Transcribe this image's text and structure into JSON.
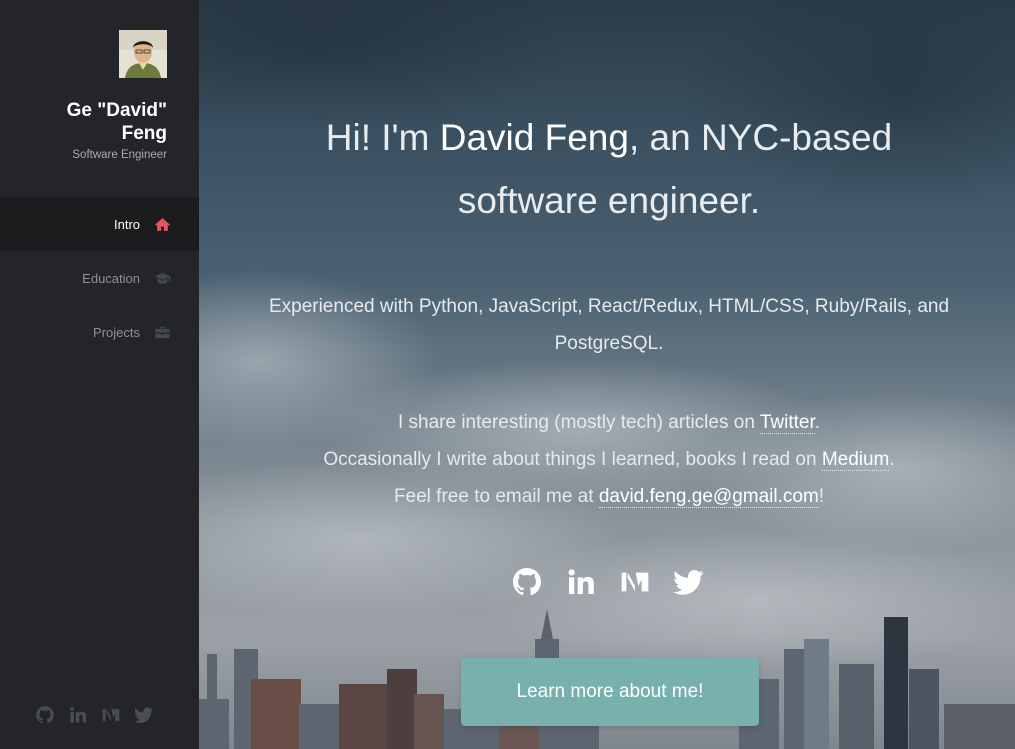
{
  "sidebar": {
    "name": "Ge \"David\" Feng",
    "role": "Software Engineer",
    "nav": [
      {
        "label": "Intro",
        "icon": "home-icon"
      },
      {
        "label": "Education",
        "icon": "graduation-cap-icon"
      },
      {
        "label": "Projects",
        "icon": "briefcase-icon"
      }
    ],
    "social_icons": [
      "github-icon",
      "linkedin-icon",
      "medium-icon",
      "twitter-icon"
    ]
  },
  "hero": {
    "title_pre": "Hi! I'm ",
    "title_name": "David Feng",
    "title_post": ", an NYC-based software engineer.",
    "skills": "Experienced with Python, JavaScript, React/Redux, HTML/CSS, Ruby/Rails, and PostgreSQL.",
    "line1_pre": "I share interesting (mostly tech) articles on ",
    "line1_link": "Twitter",
    "line1_post": ".",
    "line2_pre": "Occasionally I write about things I learned, books I read on ",
    "line2_link": "Medium",
    "line2_post": ".",
    "line3_pre": "Feel free to email me at ",
    "line3_link": "david.feng.ge@gmail.com",
    "line3_post": "!",
    "social_icons": [
      "github-icon",
      "linkedin-icon",
      "medium-icon",
      "twitter-icon"
    ],
    "cta": "Learn more about me!"
  },
  "colors": {
    "sidebar_bg": "#232528",
    "active_icon": "#e2575f",
    "button": "#78b0ad"
  }
}
